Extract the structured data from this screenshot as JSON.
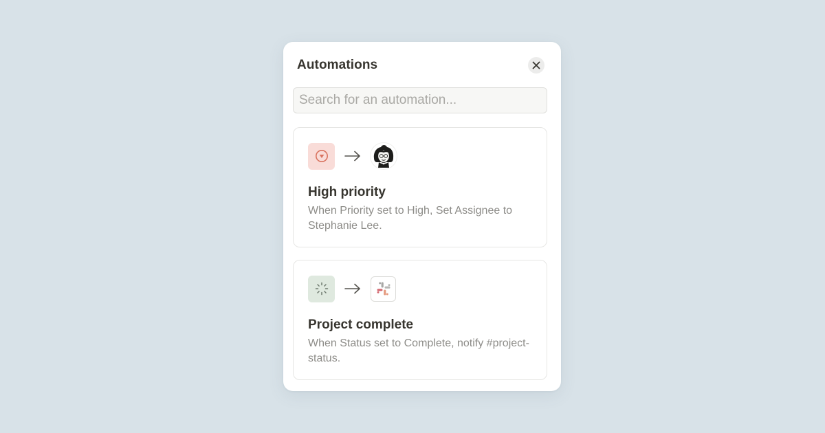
{
  "panel": {
    "title": "Automations",
    "close_icon": "close-icon"
  },
  "search": {
    "placeholder": "Search for an automation...",
    "value": ""
  },
  "automations": [
    {
      "title": "High priority",
      "description": "When Priority set to High, Set Assignee to Stephanie Lee.",
      "trigger_icon": "priority-icon",
      "arrow_icon": "arrow-right-icon",
      "action_icon": "avatar-icon",
      "trigger_color": "#f9dcd8",
      "trigger_icon_color": "#d9735f"
    },
    {
      "title": "Project complete",
      "description": "When Status set to Complete, notify #project-status.",
      "trigger_icon": "status-icon",
      "arrow_icon": "arrow-right-icon",
      "action_icon": "slack-icon",
      "trigger_color": "#dfe9df",
      "trigger_icon_color": "#6f7a6f"
    }
  ],
  "colors": {
    "background": "#d8e2e8",
    "panel": "#ffffff",
    "text_primary": "#37352f",
    "text_secondary": "#8d8c88"
  }
}
